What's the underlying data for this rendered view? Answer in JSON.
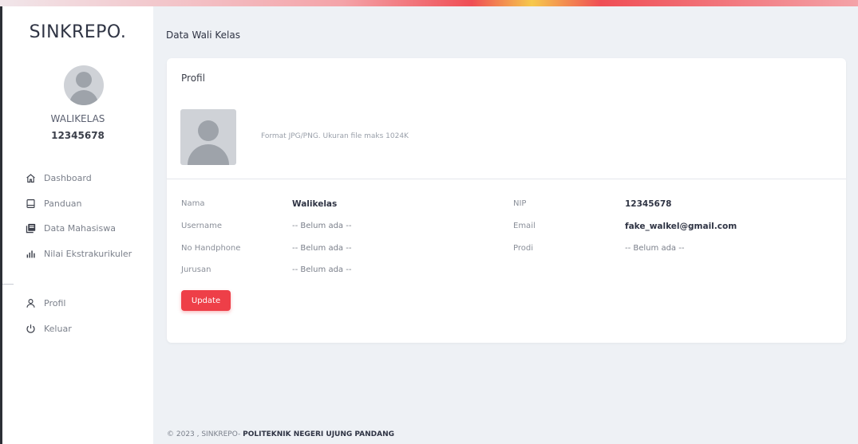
{
  "app": {
    "brand": "SINKREPO."
  },
  "user": {
    "name": "WALIKELAS",
    "id": "12345678"
  },
  "menu": [
    {
      "label": "Dashboard",
      "icon": "home-icon"
    },
    {
      "label": "Panduan",
      "icon": "book-icon"
    },
    {
      "label": "Data Mahasiswa",
      "icon": "users-list-icon"
    },
    {
      "label": "Nilai Ekstrakurikuler",
      "icon": "bar-chart-icon"
    }
  ],
  "menu_bottom": [
    {
      "label": "Profil",
      "icon": "user-icon"
    },
    {
      "label": "Keluar",
      "icon": "power-icon"
    }
  ],
  "page": {
    "title": "Data Wali Kelas"
  },
  "profile": {
    "title": "Profil",
    "photo_hint": "Format JPG/PNG. Ukuran file maks 1024K",
    "fields": {
      "nama_label": "Nama",
      "nama_value": "Walikelas",
      "username_label": "Username",
      "username_value": "-- Belum ada --",
      "hp_label": "No Handphone",
      "hp_value": "-- Belum ada --",
      "jurusan_label": "Jurusan",
      "jurusan_value": "-- Belum ada --",
      "nip_label": "NIP",
      "nip_value": "12345678",
      "email_label": "Email",
      "email_value": "fake_walkel@gmail.com",
      "prodi_label": "Prodi",
      "prodi_value": "-- Belum ada --"
    },
    "update_label": "Update"
  },
  "footer": {
    "prefix": "© 2023 , SINKREPO- ",
    "org": "POLITEKNIK NEGERI UJUNG PANDANG"
  },
  "colors": {
    "accent": "#ee3f48",
    "background": "#eef1f5",
    "card": "#ffffff"
  }
}
